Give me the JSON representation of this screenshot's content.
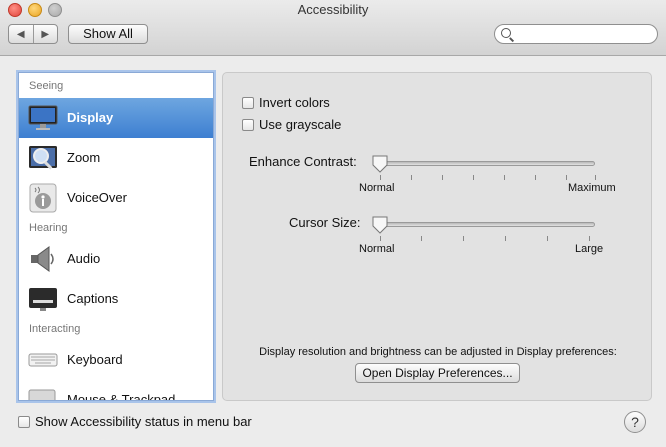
{
  "window": {
    "title": "Accessibility",
    "show_all_label": "Show All",
    "back_glyph": "◀",
    "forward_glyph": "▶",
    "search_placeholder": ""
  },
  "sidebar": {
    "sections": [
      {
        "header": "Seeing",
        "items": [
          {
            "label": "Display",
            "icon": "display-icon",
            "selected": true
          },
          {
            "label": "Zoom",
            "icon": "zoom-icon",
            "selected": false
          },
          {
            "label": "VoiceOver",
            "icon": "voiceover-icon",
            "selected": false
          }
        ]
      },
      {
        "header": "Hearing",
        "items": [
          {
            "label": "Audio",
            "icon": "speaker-icon",
            "selected": false
          },
          {
            "label": "Captions",
            "icon": "captions-icon",
            "selected": false
          }
        ]
      },
      {
        "header": "Interacting",
        "items": [
          {
            "label": "Keyboard",
            "icon": "keyboard-icon",
            "selected": false
          },
          {
            "label": "Mouse & Trackpad",
            "icon": "mouse-trackpad-icon",
            "selected": false
          }
        ]
      }
    ]
  },
  "display_panel": {
    "invert_colors": {
      "label": "Invert colors",
      "checked": false
    },
    "use_grayscale": {
      "label": "Use grayscale",
      "checked": false
    },
    "enhance_contrast": {
      "label": "Enhance Contrast:",
      "min_label": "Normal",
      "max_label": "Maximum",
      "value_fraction": 0.0
    },
    "cursor_size": {
      "label": "Cursor Size:",
      "min_label": "Normal",
      "max_label": "Large",
      "value_fraction": 0.0
    },
    "note": "Display resolution and brightness can be adjusted in Display preferences:",
    "open_button_label": "Open Display Preferences..."
  },
  "footer": {
    "status_checkbox_label": "Show Accessibility status in menu bar",
    "status_checked": false,
    "help_glyph": "?"
  },
  "colors": {
    "selection": "#3d7fd1",
    "close": "#e0443b",
    "minimize": "#e9a524"
  }
}
